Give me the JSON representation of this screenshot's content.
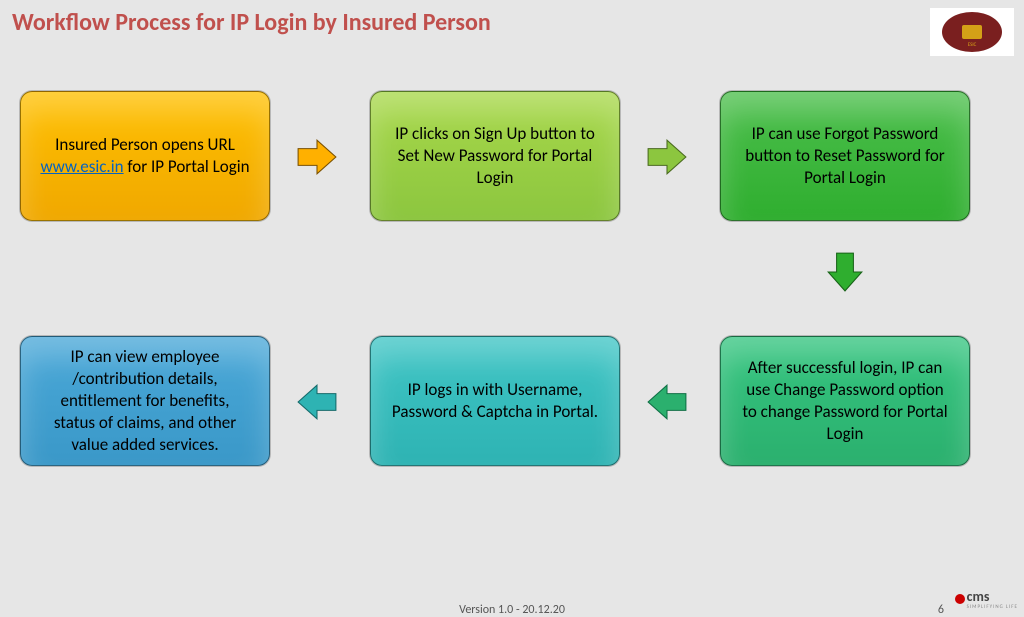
{
  "title": "Workflow Process for IP Login by Insured Person",
  "steps": {
    "s1_pre": "Insured Person opens URL ",
    "s1_link": "www.esic.in",
    "s1_post": " for IP Portal Login",
    "s2": "IP clicks on Sign Up button to Set New Password for Portal Login",
    "s3": "IP can use Forgot Password button to Reset Password for Portal Login",
    "s4": "After successful login, IP can use Change Password option to change Password for Portal Login",
    "s5": "IP logs in with Username, Password & Captcha in Portal.",
    "s6": "IP can view employee /contribution details, entitlement for benefits, status of claims, and other value added services."
  },
  "arrow_colors": {
    "a12": "#ffb000",
    "a23": "#8cc63f",
    "a34": "#2fae2f",
    "a45": "#2bb06e",
    "a56": "#2eb3b3"
  },
  "footer": {
    "version": "Version 1.0 - 20.12.20",
    "page": "6",
    "brand": "cms",
    "brand_sub": "SIMPLIFYING LIFE"
  },
  "logo_label": "ESIC"
}
